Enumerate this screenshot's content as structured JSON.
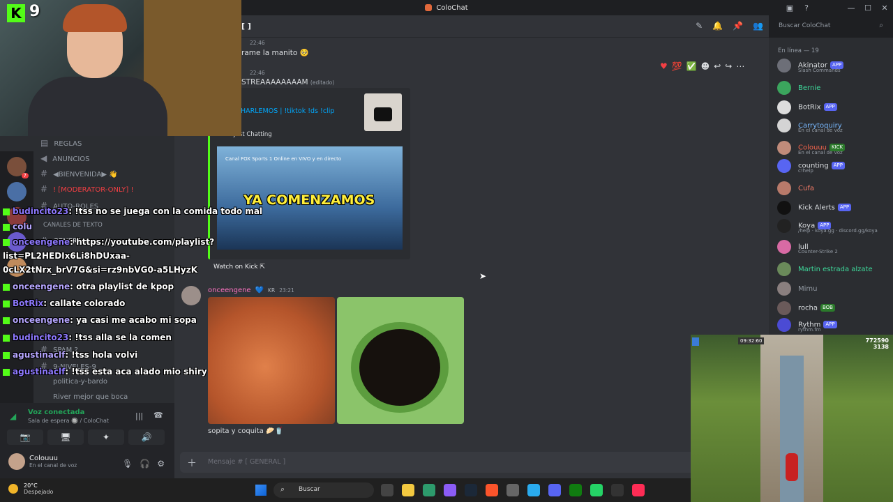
{
  "window": {
    "title": "ColoChat"
  },
  "header": {
    "channel": "[ ]",
    "search_placeholder": "Buscar ColoChat"
  },
  "messages": [
    {
      "time": "22:46",
      "text": "rame la manito 🥺"
    },
    {
      "time": "22:46",
      "text": "STREAAAAAAAAM",
      "edited": "(editado)"
    }
  ],
  "embed": {
    "title": "HARLEMOS | !tiktok !ds !clip",
    "subtitle": "Just Chatting",
    "video_caption": "Canal FOX Sports 1 Online en VIVO y en directo",
    "video_overlay": "YA COMENZAMOS",
    "watch_label": "Watch on Kick"
  },
  "post": {
    "author": "onceengene",
    "server_tag": "KR",
    "time": "23:21",
    "caption": "sopita y coquita 🥟🥤"
  },
  "composer": {
    "placeholder": "Mensaje # [ GENERAL ]"
  },
  "sidebar": {
    "channels": [
      {
        "name": "REGLAS"
      },
      {
        "name": "ANUNCIOS"
      },
      {
        "name": "◀BIENVENIDA▶ 👋"
      },
      {
        "name": "! [MODERATOR-ONLY] !"
      },
      {
        "name": "AUTO-ROLES"
      },
      {
        "name": "CANALES DE TEXTO"
      },
      {
        "name": "GENERAL"
      },
      {
        "name": "SPAM ?"
      },
      {
        "name": "9-NIVELES-9"
      },
      {
        "name": "politica-y-bardo"
      },
      {
        "name": "River mejor que boca"
      }
    ]
  },
  "voice": {
    "status": "Voz conectada",
    "location": "Sala de espera 🔘 / ColoChat",
    "buttons": [
      "📷",
      "🖥",
      "✦",
      "🔊"
    ]
  },
  "user": {
    "name": "Colouuu",
    "status": "En el canal de voz"
  },
  "members": {
    "heading": "En línea — 19",
    "list": [
      {
        "name": "Akinator",
        "tag": "APP",
        "status": "Slash Commands",
        "color": "#dbdee1"
      },
      {
        "name": "Bernie",
        "tag": "",
        "status": "",
        "color": "#3ed99b"
      },
      {
        "name": "BotRix",
        "tag": "APP",
        "status": "",
        "color": "#dbdee1"
      },
      {
        "name": "Carrytoquiry",
        "tag": "",
        "status": "En el canal de voz",
        "color": "#79b9ff"
      },
      {
        "name": "Colouuu",
        "tag": "KICK",
        "status": "En el canal de voz",
        "color": "#f2634b"
      },
      {
        "name": "counting",
        "tag": "APP",
        "status": "c!help",
        "color": "#dbdee1"
      },
      {
        "name": "Cufa",
        "tag": "",
        "status": "",
        "color": "#f47b67"
      },
      {
        "name": "Kick Alerts",
        "tag": "APP",
        "status": "",
        "color": "#dbdee1"
      },
      {
        "name": "Koya",
        "tag": "APP",
        "status": "/help · koya.gg · discord.gg/koya",
        "color": "#dbdee1"
      },
      {
        "name": "lull",
        "tag": "",
        "status": "Counter-Strike 2",
        "color": "#dbdee1"
      },
      {
        "name": "Martin estrada alzate",
        "tag": "",
        "status": "",
        "color": "#3ed99b"
      },
      {
        "name": "Mimu",
        "tag": "",
        "status": "",
        "color": "#949ba4"
      },
      {
        "name": "rocha",
        "tag": "BOB",
        "status": "",
        "color": "#dbdee1"
      },
      {
        "name": "Rythm",
        "tag": "APP",
        "status": "rythm.fm",
        "color": "#dbdee1"
      }
    ]
  },
  "overlay": {
    "viewers": "9",
    "chat": [
      {
        "user": "budincito23",
        "msg": ": !tss no se juega con la comida todo mal"
      },
      {
        "user": "colu",
        "msg": ""
      },
      {
        "user": "onceengene",
        "msg": ": https://youtube.com/playlist?"
      },
      {
        "user": "",
        "msg": "list=PL2HEDIx6Li8hDUxaa-"
      },
      {
        "user": "",
        "msg": "0cLX2tNrx_brV7G&si=rz9nbVG0-a5LHyzK"
      },
      {
        "user": "onceengene",
        "msg": ": otra playlist de kpop"
      },
      {
        "user": "BotRix",
        "msg": ": callate colorado"
      },
      {
        "user": "onceengene",
        "msg": ": ya casi me acabo mi sopa"
      },
      {
        "user": "budincito23",
        "msg": ": !tss alla se la comen"
      },
      {
        "user": "agustinaclf",
        "msg": ": !tss hola volvi"
      },
      {
        "user": "agustinaclf",
        "msg": ": !tss esta aca alado mio shiry"
      }
    ],
    "game": {
      "timer": "09:32:60",
      "score": "772590",
      "coins": "3138"
    }
  },
  "taskbar": {
    "temp": "20°C",
    "condition": "Despejado",
    "search": "Buscar"
  }
}
